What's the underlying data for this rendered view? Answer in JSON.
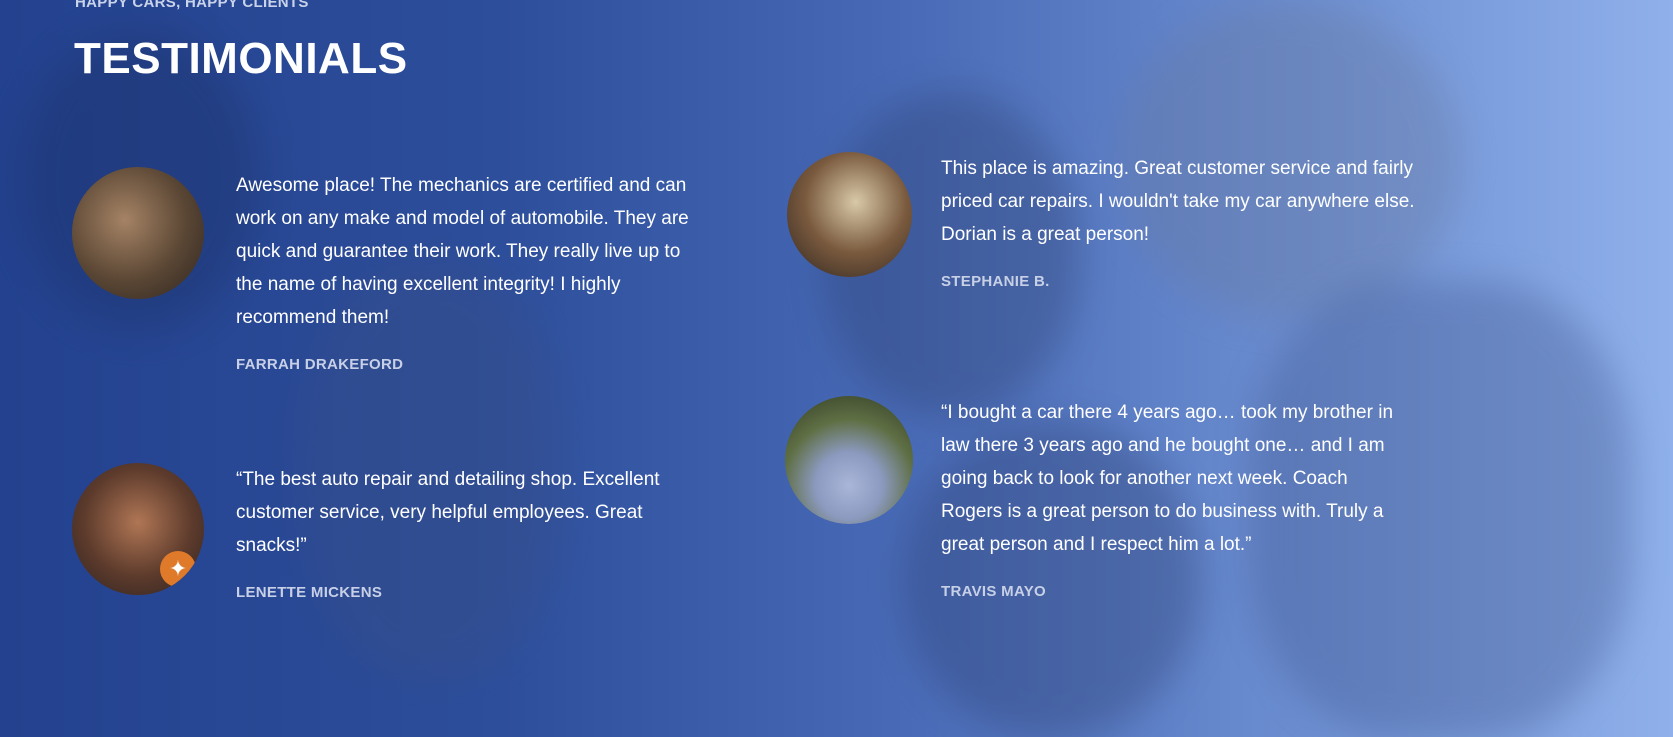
{
  "section": {
    "eyebrow": "HAPPY CARS, HAPPY CLIENTS",
    "title": "TESTIMONIALS"
  },
  "testimonials": [
    {
      "quote": "Awesome place! The mechanics are certified and can work on any make and model of automobile. They are quick and guarantee their work. They really live up to the name of having excellent integrity! I highly recommend them!",
      "author": "FARRAH DRAKEFORD",
      "avatar_icon": "dogs-photo-avatar"
    },
    {
      "quote": "This place is amazing. Great customer service and fairly priced car repairs. I wouldn't take my car anywhere else. Dorian is a great person!",
      "author": "STEPHANIE B.",
      "avatar_icon": "woman-photo-avatar"
    },
    {
      "quote": "“The best auto repair and detailing shop. Excellent customer service, very helpful employees. Great snacks!”",
      "author": "LENETTE MICKENS",
      "avatar_icon": "group-photo-avatar",
      "badge_icon": "star-badge-icon"
    },
    {
      "quote": "“I bought a car there 4 years ago… took my brother in law there 3 years ago and he bought one… and I am going back to look for another next week. Coach Rogers is a great person to do business with. Truly a great person and I respect him a lot.”",
      "author": "TRAVIS MAYO",
      "avatar_icon": "man-photo-avatar"
    }
  ],
  "colors": {
    "background_left": "#23418e",
    "background_right": "#8fb0ea",
    "text": "#ffffff",
    "author": "#c7d0e6",
    "badge": "#e07a2b"
  }
}
